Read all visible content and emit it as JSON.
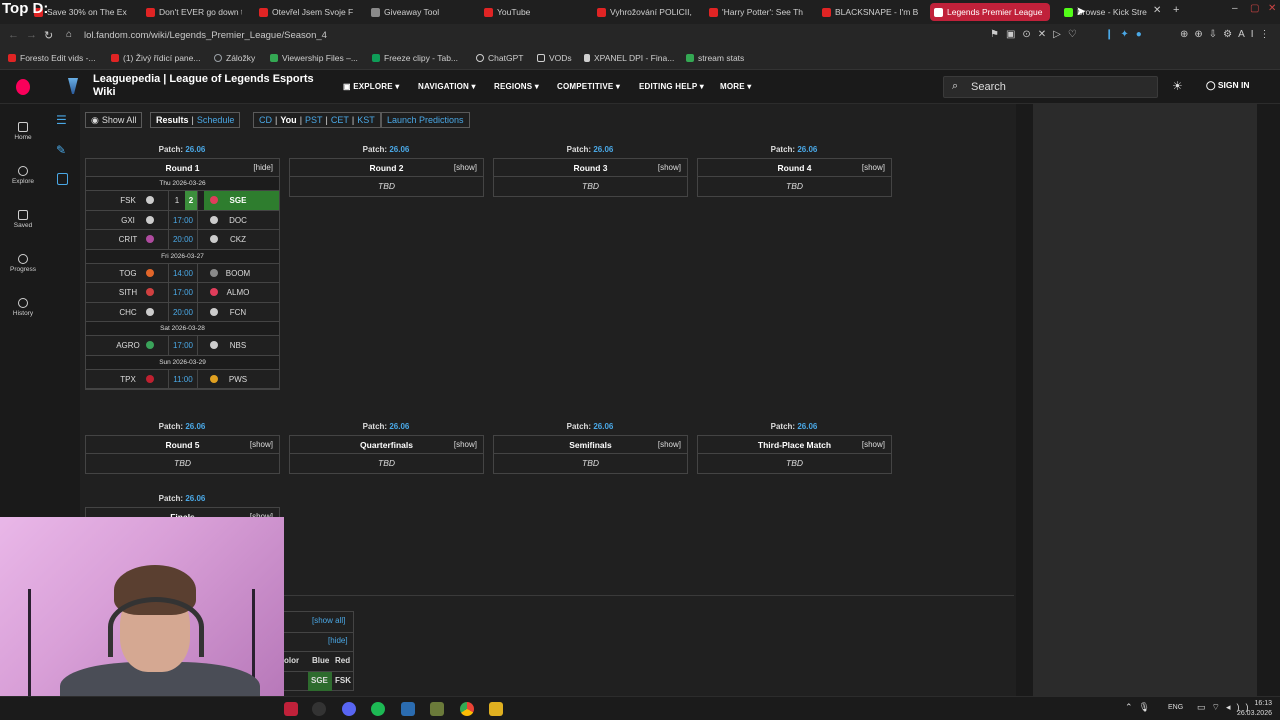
{
  "overlay_text": "Top D:",
  "tabs": [
    {
      "label": "Save 30% on The Ex",
      "color": "#e02424"
    },
    {
      "label": "Don't EVER go down t",
      "color": "#e02424"
    },
    {
      "label": "Otevřel Jsem Svoje F",
      "color": "#e02424"
    },
    {
      "label": "Giveaway Tool",
      "color": "#8a8a8a"
    },
    {
      "label": "YouTube",
      "color": "#e02424"
    },
    {
      "label": "Vyhrožování POLICII,",
      "color": "#e02424"
    },
    {
      "label": "'Harry Potter': See Th",
      "color": "#e02424"
    },
    {
      "label": "BLACKSNAPE - I'm Bl",
      "color": "#e02424"
    },
    {
      "label": "Legends Premier League",
      "color": "#ffffff",
      "active": true
    },
    {
      "label": "Browse - Kick Stre",
      "color": "#53fc18"
    }
  ],
  "address": {
    "url": "lol.fandom.com/wiki/Legends_Premier_League/Season_4"
  },
  "bookmarks": [
    {
      "label": "Foresto Edit vids -...",
      "color": "#e02424"
    },
    {
      "label": "(1) Živý řídicí pane...",
      "color": "#e02424"
    },
    {
      "label": "Záložky",
      "color": "#9aa0a6"
    },
    {
      "label": "Viewership Files –...",
      "color": "#34a853"
    },
    {
      "label": "Freeze clipy - Tab...",
      "color": "#0f9d58"
    },
    {
      "label": "ChatGPT",
      "color": "#cfcfcf"
    },
    {
      "label": "VODs",
      "color": "#cfcfcf"
    },
    {
      "label": "XPANEL DPI - Fina...",
      "color": "#cfcfcf"
    },
    {
      "label": "stream stats",
      "color": "#34a853"
    }
  ],
  "site": {
    "title_line1": "Leaguepedia | League of Legends Esports",
    "title_line2": "Wiki",
    "nav": [
      "EXPLORE",
      "NAVIGATION",
      "REGIONS",
      "COMPETITIVE",
      "EDITING HELP",
      "MORE"
    ],
    "search_placeholder": "Search",
    "signin": "SIGN IN"
  },
  "rail": [
    "Home",
    "Explore",
    "Saved",
    "Progress",
    "History"
  ],
  "controls": {
    "show_all": "Show All",
    "results": "Results",
    "schedule": "Schedule",
    "tz_cd": "CD",
    "tz_you": "You",
    "tz_pst": "PST",
    "tz_cet": "CET",
    "tz_kst": "KST",
    "predictions": "Launch Predictions"
  },
  "patch_label": "Patch:",
  "patch_value": "26.06",
  "toggles": {
    "hide": "[hide]",
    "show": "[show]",
    "show_all": "[show all]"
  },
  "tbd": "TBD",
  "round1": {
    "name": "Round 1",
    "days": [
      {
        "date": "Thu 2026-03-26",
        "matches": [
          {
            "t1": "FSK",
            "s1": "1",
            "s2": "2",
            "t2": "SGE",
            "i1": "#cccccc",
            "i2": "#e03d5b",
            "winner": "t2"
          },
          {
            "t1": "GXI",
            "time": "17:00",
            "t2": "DOC",
            "i1": "#cccccc",
            "i2": "#cccccc"
          },
          {
            "t1": "CRIT",
            "time": "20:00",
            "t2": "CKZ",
            "i1": "#b04ba0",
            "i2": "#cccccc"
          }
        ]
      },
      {
        "date": "Fri 2026-03-27",
        "matches": [
          {
            "t1": "TOG",
            "time": "14:00",
            "t2": "BOOM",
            "i1": "#e2662a",
            "i2": "#8a8a8a"
          },
          {
            "t1": "SITH",
            "time": "17:00",
            "t2": "ALMO",
            "i1": "#d04040",
            "i2": "#e03d5b"
          },
          {
            "t1": "CHC",
            "time": "20:00",
            "t2": "FCN",
            "i1": "#cccccc",
            "i2": "#cccccc"
          }
        ]
      },
      {
        "date": "Sat 2026-03-28",
        "matches": [
          {
            "t1": "AGRO",
            "time": "17:00",
            "t2": "NBS",
            "i1": "#3aa35a",
            "i2": "#cccccc"
          }
        ]
      },
      {
        "date": "Sun 2026-03-29",
        "matches": [
          {
            "t1": "TPX",
            "time": "11:00",
            "t2": "PWS",
            "i1": "#c02030",
            "i2": "#e0a020"
          }
        ]
      }
    ]
  },
  "other_rounds": [
    "Round 2",
    "Round 3",
    "Round 4",
    "Round 5",
    "Quarterfinals",
    "Semifinals",
    "Third-Place Match",
    "Finals"
  ],
  "bottom_table": {
    "header": [
      "olor",
      "Blue",
      "Red"
    ],
    "row": [
      "SGE",
      "FSK"
    ]
  },
  "clock": {
    "time": "16:13",
    "date": "26.03.2026"
  },
  "lang": "ENG"
}
